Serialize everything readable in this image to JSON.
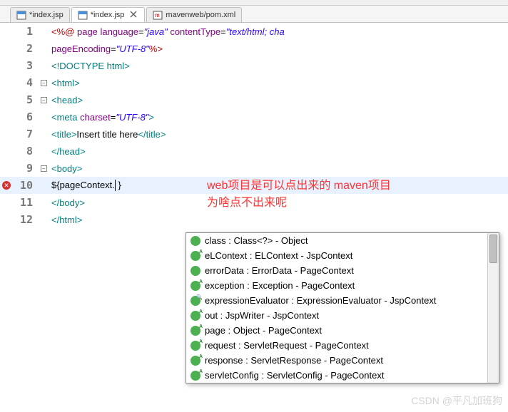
{
  "tabs": [
    {
      "label": "*index.jsp",
      "active": false
    },
    {
      "label": "*index.jsp",
      "active": true
    },
    {
      "label": "mavenweb/pom.xml",
      "active": false
    }
  ],
  "lines": [
    {
      "n": "1",
      "html": "<span class='dir'>&lt;%@</span> <span class='attr'>page</span> <span class='attr'>language</span><span class='txt'>=</span><span class='str'>\"java\"</span> <span class='attr'>contentType</span><span class='txt'>=</span><span class='str'>\"text/html; cha</span>"
    },
    {
      "n": "2",
      "html": "    <span class='attr'>pageEncoding</span><span class='txt'>=</span><span class='str'>\"UTF-8\"</span><span class='dir'>%&gt;</span>"
    },
    {
      "n": "3",
      "html": "<span class='tag'>&lt;!DOCTYPE</span> <span class='tag'>html&gt;</span>"
    },
    {
      "n": "4",
      "fold": true,
      "html": "<span class='tag'>&lt;html&gt;</span>"
    },
    {
      "n": "5",
      "fold": true,
      "html": "<span class='tag'>&lt;head&gt;</span>"
    },
    {
      "n": "6",
      "html": "<span class='tag'>&lt;meta</span> <span class='attr'>charset</span><span class='txt'>=</span><span class='str'>\"UTF-8\"</span><span class='tag'>&gt;</span>"
    },
    {
      "n": "7",
      "html": "<span class='tag'>&lt;title&gt;</span><span class='black'>Insert title here</span><span class='tag'>&lt;/title&gt;</span>"
    },
    {
      "n": "8",
      "html": "<span class='tag'>&lt;/head&gt;</span>"
    },
    {
      "n": "9",
      "fold": true,
      "html": "<span class='tag'>&lt;body&gt;</span>"
    },
    {
      "n": "10",
      "error": true,
      "highlight": true,
      "html": "<span class='black'>${pageContext.</span><span class='cursor-caret'></span><span class='black'> }</span>"
    },
    {
      "n": "11",
      "html": "<span class='tag'>&lt;/body&gt;</span>"
    },
    {
      "n": "12",
      "html": "<span class='tag'>&lt;/html&gt;</span>"
    }
  ],
  "annotation": {
    "line1": "web项目是可以点出来的 maven项目",
    "line2": "为啥点不出来呢"
  },
  "autocomplete": [
    {
      "icon": "green",
      "label": "class : Class<?> - Object"
    },
    {
      "icon": "green-a",
      "label": "eLContext : ELContext - JspContext"
    },
    {
      "icon": "green",
      "label": "errorData : ErrorData - PageContext"
    },
    {
      "icon": "green-a",
      "label": "exception : Exception - PageContext"
    },
    {
      "icon": "green-search",
      "label": "expressionEvaluator : ExpressionEvaluator - JspContext"
    },
    {
      "icon": "green-a",
      "label": "out : JspWriter - JspContext"
    },
    {
      "icon": "green-a",
      "label": "page : Object - PageContext"
    },
    {
      "icon": "green-a",
      "label": "request : ServletRequest - PageContext"
    },
    {
      "icon": "green-a",
      "label": "response : ServletResponse - PageContext"
    },
    {
      "icon": "green-a",
      "label": "servletConfig : ServletConfig - PageContext"
    }
  ],
  "watermark": "CSDN @平凡加班狗"
}
